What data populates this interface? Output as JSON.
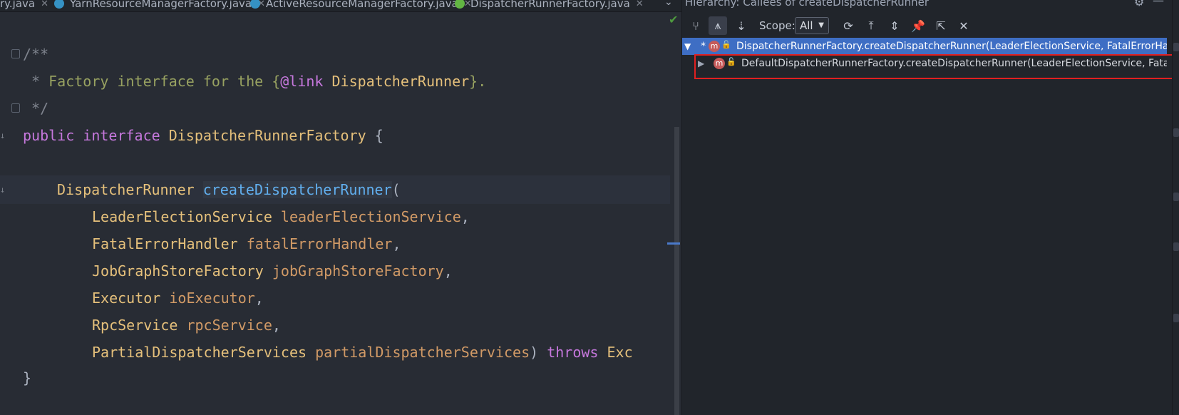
{
  "tabs": [
    {
      "label": "ry.java",
      "active": false
    },
    {
      "label": "YarnResourceManagerFactory.java",
      "active": false
    },
    {
      "label": "ActiveResourceManagerFactory.java",
      "active": false
    },
    {
      "label": "DispatcherRunnerFactory.java",
      "active": true
    }
  ],
  "tab_close_glyph": "✕",
  "editor": {
    "lines": {
      "doc_open": "/**",
      "doc_star": " * ",
      "doc_text": "Factory interface for the ",
      "doc_brace_open": "{",
      "doc_link_tag": "@link",
      "doc_link_target": " DispatcherRunner",
      "doc_brace_close": "}.",
      "doc_close": " */",
      "kw_public": "public",
      "kw_interface": "interface",
      "interface_name": "DispatcherRunnerFactory",
      "open_brace": "{",
      "return_type": "DispatcherRunner",
      "method_name": "createDispatcherRunner",
      "open_paren": "(",
      "params": [
        {
          "type": "LeaderElectionService",
          "name": "leaderElectionService",
          "suffix": ","
        },
        {
          "type": "FatalErrorHandler",
          "name": "fatalErrorHandler",
          "suffix": ","
        },
        {
          "type": "JobGraphStoreFactory",
          "name": "jobGraphStoreFactory",
          "suffix": ","
        },
        {
          "type": "Executor",
          "name": "ioExecutor",
          "suffix": ","
        },
        {
          "type": "RpcService",
          "name": "rpcService",
          "suffix": ","
        },
        {
          "type": "PartialDispatcherServices",
          "name": "partialDispatcherServices",
          "suffix": ")"
        }
      ],
      "kw_throws": "throws",
      "throws_type": "Exc",
      "close_brace": "}"
    }
  },
  "panel": {
    "title": "Hierarchy:  Callees of createDispatcherRunner",
    "scope_label": "Scope:",
    "scope_value": "All",
    "tree": [
      {
        "label": "DispatcherRunnerFactory.createDispatcherRunner(LeaderElectionService, FatalErrorHandler",
        "marker": "*",
        "expanded": true,
        "selected": true
      },
      {
        "label": "DefaultDispatcherRunnerFactory.createDispatcherRunner(LeaderElectionService, FatalErrorH",
        "marker": "",
        "expanded": false,
        "selected": false
      }
    ],
    "icon_letter": "m"
  },
  "colors": {
    "selection": "#3e6ec4",
    "highlight_box": "#e02020",
    "keyword": "#c678dd",
    "type": "#e5c07b",
    "param": "#d19a66",
    "method": "#61afef"
  }
}
